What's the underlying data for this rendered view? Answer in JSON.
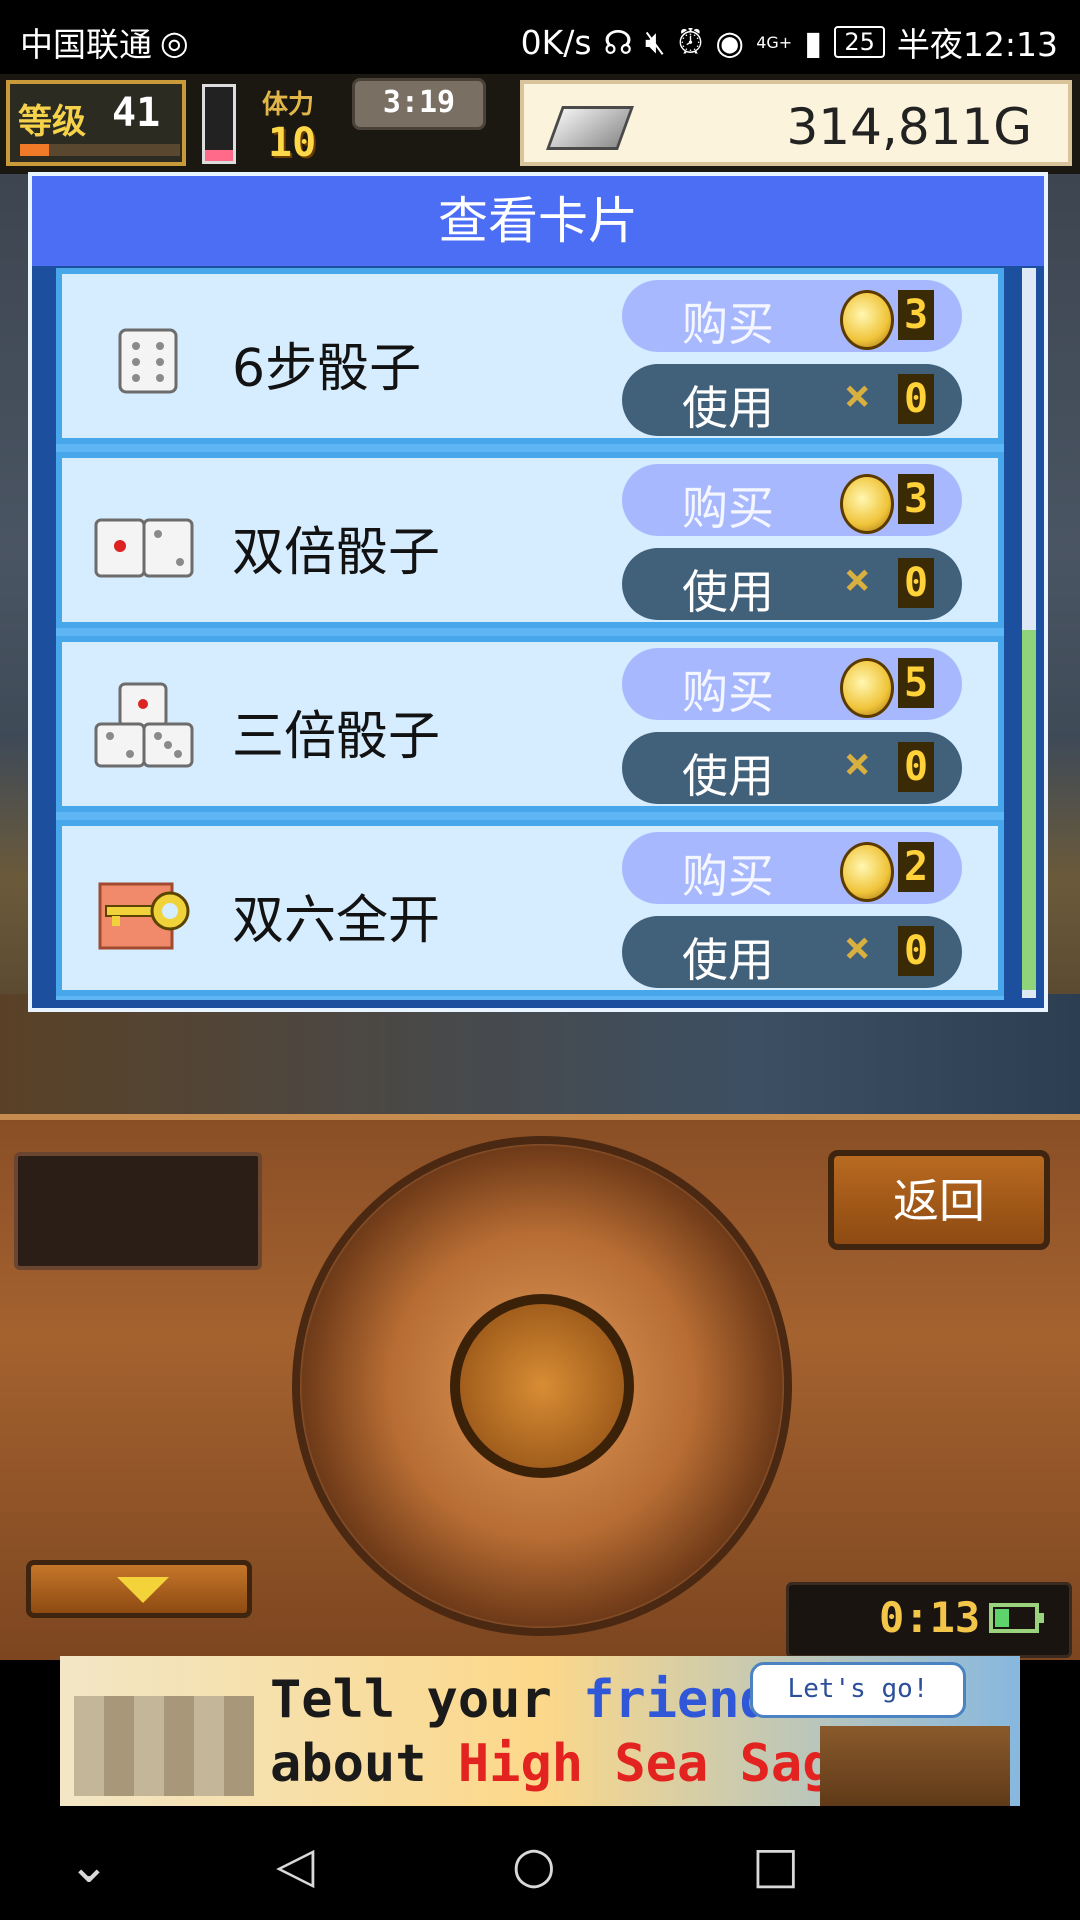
{
  "status_bar": {
    "carrier": "中国联通",
    "net_speed": "0K/s",
    "network": "4G+",
    "battery": "25",
    "time": "半夜12:13"
  },
  "hud": {
    "level_label": "等级",
    "level_value": "41",
    "xp_progress": 0.18,
    "stamina_meter": 0.15,
    "stamina_label": "体力",
    "stamina_value": "10",
    "timer": "3:19",
    "gold": "314,811G"
  },
  "dialog": {
    "title": "查看卡片",
    "cards": [
      {
        "name": "6步骰子",
        "buy_label": "购买",
        "use_label": "使用",
        "cost": "3",
        "owned": "0",
        "icon": "dice-six-icon"
      },
      {
        "name": "双倍骰子",
        "buy_label": "购买",
        "use_label": "使用",
        "cost": "3",
        "owned": "0",
        "icon": "double-dice-icon"
      },
      {
        "name": "三倍骰子",
        "buy_label": "购买",
        "use_label": "使用",
        "cost": "5",
        "owned": "0",
        "icon": "triple-dice-icon"
      },
      {
        "name": "双六全开",
        "buy_label": "购买",
        "use_label": "使用",
        "cost": "2",
        "owned": "0",
        "icon": "key-icon"
      }
    ],
    "scroll_position": 0.55
  },
  "panel": {
    "back_label": "返回",
    "clock": "0:13"
  },
  "ad": {
    "line1_a": "Tell your ",
    "line1_b": "friends",
    "line2_a": "about ",
    "line2_b": "High Sea Saga!",
    "bubble": "Let's go!"
  },
  "colors": {
    "dialog_title_bg": "#4c6ef5",
    "card_bg": "#d6ecff",
    "buy_button": "#a8b8ff",
    "use_button": "#41607a",
    "panel_wood": "#a4622f"
  }
}
